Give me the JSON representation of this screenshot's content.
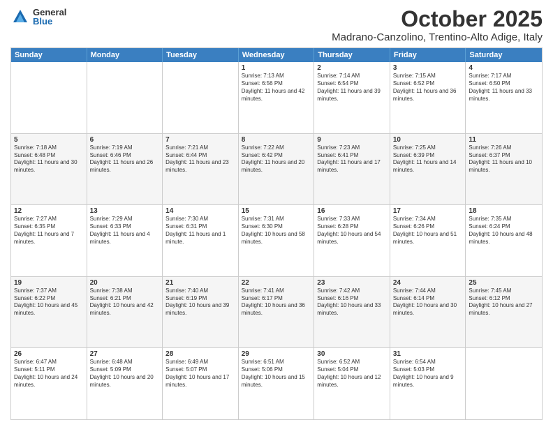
{
  "logo": {
    "general": "General",
    "blue": "Blue"
  },
  "header": {
    "month": "October 2025",
    "location": "Madrano-Canzolino, Trentino-Alto Adige, Italy"
  },
  "weekdays": [
    "Sunday",
    "Monday",
    "Tuesday",
    "Wednesday",
    "Thursday",
    "Friday",
    "Saturday"
  ],
  "rows": [
    [
      {
        "day": "",
        "text": ""
      },
      {
        "day": "",
        "text": ""
      },
      {
        "day": "",
        "text": ""
      },
      {
        "day": "1",
        "text": "Sunrise: 7:13 AM\nSunset: 6:56 PM\nDaylight: 11 hours and 42 minutes."
      },
      {
        "day": "2",
        "text": "Sunrise: 7:14 AM\nSunset: 6:54 PM\nDaylight: 11 hours and 39 minutes."
      },
      {
        "day": "3",
        "text": "Sunrise: 7:15 AM\nSunset: 6:52 PM\nDaylight: 11 hours and 36 minutes."
      },
      {
        "day": "4",
        "text": "Sunrise: 7:17 AM\nSunset: 6:50 PM\nDaylight: 11 hours and 33 minutes."
      }
    ],
    [
      {
        "day": "5",
        "text": "Sunrise: 7:18 AM\nSunset: 6:48 PM\nDaylight: 11 hours and 30 minutes."
      },
      {
        "day": "6",
        "text": "Sunrise: 7:19 AM\nSunset: 6:46 PM\nDaylight: 11 hours and 26 minutes."
      },
      {
        "day": "7",
        "text": "Sunrise: 7:21 AM\nSunset: 6:44 PM\nDaylight: 11 hours and 23 minutes."
      },
      {
        "day": "8",
        "text": "Sunrise: 7:22 AM\nSunset: 6:42 PM\nDaylight: 11 hours and 20 minutes."
      },
      {
        "day": "9",
        "text": "Sunrise: 7:23 AM\nSunset: 6:41 PM\nDaylight: 11 hours and 17 minutes."
      },
      {
        "day": "10",
        "text": "Sunrise: 7:25 AM\nSunset: 6:39 PM\nDaylight: 11 hours and 14 minutes."
      },
      {
        "day": "11",
        "text": "Sunrise: 7:26 AM\nSunset: 6:37 PM\nDaylight: 11 hours and 10 minutes."
      }
    ],
    [
      {
        "day": "12",
        "text": "Sunrise: 7:27 AM\nSunset: 6:35 PM\nDaylight: 11 hours and 7 minutes."
      },
      {
        "day": "13",
        "text": "Sunrise: 7:29 AM\nSunset: 6:33 PM\nDaylight: 11 hours and 4 minutes."
      },
      {
        "day": "14",
        "text": "Sunrise: 7:30 AM\nSunset: 6:31 PM\nDaylight: 11 hours and 1 minute."
      },
      {
        "day": "15",
        "text": "Sunrise: 7:31 AM\nSunset: 6:30 PM\nDaylight: 10 hours and 58 minutes."
      },
      {
        "day": "16",
        "text": "Sunrise: 7:33 AM\nSunset: 6:28 PM\nDaylight: 10 hours and 54 minutes."
      },
      {
        "day": "17",
        "text": "Sunrise: 7:34 AM\nSunset: 6:26 PM\nDaylight: 10 hours and 51 minutes."
      },
      {
        "day": "18",
        "text": "Sunrise: 7:35 AM\nSunset: 6:24 PM\nDaylight: 10 hours and 48 minutes."
      }
    ],
    [
      {
        "day": "19",
        "text": "Sunrise: 7:37 AM\nSunset: 6:22 PM\nDaylight: 10 hours and 45 minutes."
      },
      {
        "day": "20",
        "text": "Sunrise: 7:38 AM\nSunset: 6:21 PM\nDaylight: 10 hours and 42 minutes."
      },
      {
        "day": "21",
        "text": "Sunrise: 7:40 AM\nSunset: 6:19 PM\nDaylight: 10 hours and 39 minutes."
      },
      {
        "day": "22",
        "text": "Sunrise: 7:41 AM\nSunset: 6:17 PM\nDaylight: 10 hours and 36 minutes."
      },
      {
        "day": "23",
        "text": "Sunrise: 7:42 AM\nSunset: 6:16 PM\nDaylight: 10 hours and 33 minutes."
      },
      {
        "day": "24",
        "text": "Sunrise: 7:44 AM\nSunset: 6:14 PM\nDaylight: 10 hours and 30 minutes."
      },
      {
        "day": "25",
        "text": "Sunrise: 7:45 AM\nSunset: 6:12 PM\nDaylight: 10 hours and 27 minutes."
      }
    ],
    [
      {
        "day": "26",
        "text": "Sunrise: 6:47 AM\nSunset: 5:11 PM\nDaylight: 10 hours and 24 minutes."
      },
      {
        "day": "27",
        "text": "Sunrise: 6:48 AM\nSunset: 5:09 PM\nDaylight: 10 hours and 20 minutes."
      },
      {
        "day": "28",
        "text": "Sunrise: 6:49 AM\nSunset: 5:07 PM\nDaylight: 10 hours and 17 minutes."
      },
      {
        "day": "29",
        "text": "Sunrise: 6:51 AM\nSunset: 5:06 PM\nDaylight: 10 hours and 15 minutes."
      },
      {
        "day": "30",
        "text": "Sunrise: 6:52 AM\nSunset: 5:04 PM\nDaylight: 10 hours and 12 minutes."
      },
      {
        "day": "31",
        "text": "Sunrise: 6:54 AM\nSunset: 5:03 PM\nDaylight: 10 hours and 9 minutes."
      },
      {
        "day": "",
        "text": ""
      }
    ]
  ]
}
